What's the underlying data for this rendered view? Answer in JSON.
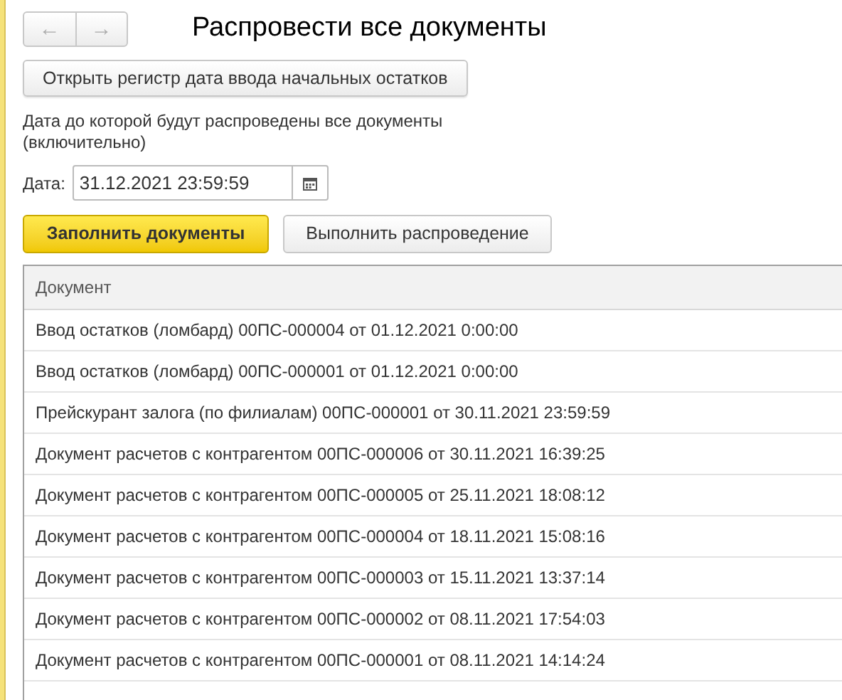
{
  "navigation": {
    "back": "←",
    "forward": "→"
  },
  "window": {
    "title": "Распровести все документы"
  },
  "open_register_button": "Открыть регистр дата ввода начальных остатков",
  "date_hint": "Дата до которой будут распроведены все документы (включительно)",
  "date_field": {
    "label": "Дата:",
    "value": "31.12.2021 23:59:59"
  },
  "buttons": [
    {
      "label": "Заполнить документы",
      "kind": "primary"
    },
    {
      "label": "Выполнить распроведение",
      "kind": "normal"
    }
  ],
  "table": {
    "columns": [
      "Документ"
    ],
    "rows": [
      "Ввод остатков (ломбард) 00ПС-000004 от 01.12.2021 0:00:00",
      "Ввод остатков (ломбард) 00ПС-000001 от 01.12.2021 0:00:00",
      "Прейскурант залога (по филиалам) 00ПС-000001 от 30.11.2021 23:59:59",
      "Документ расчетов с контрагентом 00ПС-000006 от 30.11.2021 16:39:25",
      "Документ расчетов с контрагентом 00ПС-000005 от 25.11.2021 18:08:12",
      "Документ расчетов с контрагентом 00ПС-000004 от 18.11.2021 15:08:16",
      "Документ расчетов с контрагентом 00ПС-000003 от 15.11.2021 13:37:14",
      "Документ расчетов с контрагентом 00ПС-000002 от 08.11.2021 17:54:03",
      "Документ расчетов с контрагентом 00ПС-000001 от 08.11.2021 14:14:24"
    ]
  }
}
